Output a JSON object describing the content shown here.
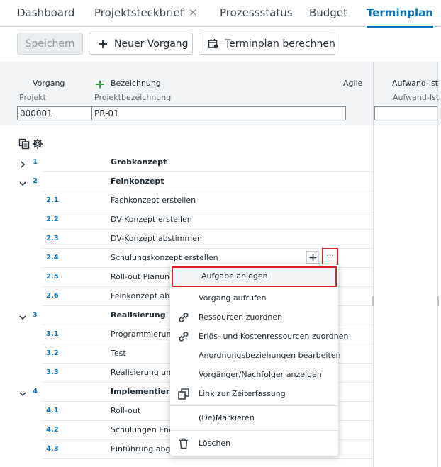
{
  "tabs": [
    {
      "label": "Dashboard"
    },
    {
      "label": "Projektsteckbrief",
      "close": "✕"
    },
    {
      "label": "Prozessstatus"
    },
    {
      "label": "Budget"
    },
    {
      "label": "Terminplan"
    }
  ],
  "toolbar": {
    "save_label": "Speichern",
    "new_task_label": "Neuer Vorgang",
    "calc_label": "Terminplan berechnen"
  },
  "header": {
    "vorgang": "Vorgang",
    "bezeichnung": "Bezeichnung",
    "agile": "Agile",
    "aufwand": "Aufwand-Ist",
    "projekt": "Projekt",
    "projektbezeichnung": "Projektbezeichnung",
    "aufwand_sub": "Aufwand-Ist",
    "projekt_value": "000001",
    "bezeichnung_value": "PR-01",
    "aufwand_value": ""
  },
  "rows": [
    {
      "num": "1",
      "text": "Grobkonzept",
      "level": 1,
      "expanded": false
    },
    {
      "num": "2",
      "text": "Feinkonzept",
      "level": 1,
      "expanded": true
    },
    {
      "num": "2.1",
      "text": "Fachkonzept erstellen",
      "level": 2
    },
    {
      "num": "2.2",
      "text": "DV-Konzept erstellen",
      "level": 2
    },
    {
      "num": "2.3",
      "text": "DV-Konzept abstimmen",
      "level": 2
    },
    {
      "num": "2.4",
      "text": "Schulungskonzept erstellen",
      "level": 2
    },
    {
      "num": "2.5",
      "text": "Roll-out Planung",
      "level": 2
    },
    {
      "num": "2.6",
      "text": "Feinkonzept abge",
      "level": 2
    },
    {
      "num": "3",
      "text": "Realisierung",
      "level": 1,
      "expanded": true
    },
    {
      "num": "3.1",
      "text": "Programmierung",
      "level": 2
    },
    {
      "num": "3.2",
      "text": "Test",
      "level": 2
    },
    {
      "num": "3.3",
      "text": "Realisierung und",
      "level": 2
    },
    {
      "num": "4",
      "text": "Implementierung",
      "level": 1,
      "expanded": true
    },
    {
      "num": "4.1",
      "text": "Roll-out",
      "level": 2
    },
    {
      "num": "4.2",
      "text": "Schulungen Enda",
      "level": 2
    },
    {
      "num": "4.3",
      "text": "Einführung abges",
      "level": 2
    }
  ],
  "row_actions": {
    "more": "···"
  },
  "menu": {
    "items": [
      {
        "label": "Aufgabe anlegen",
        "icon": "",
        "highlighted": true
      },
      {
        "label": "Vorgang aufrufen",
        "icon": ""
      },
      {
        "label": "Ressourcen zuordnen",
        "icon": "link-icon"
      },
      {
        "label": "Erlös- und Kostenressourcen zuordnen",
        "icon": "link-icon"
      },
      {
        "label": "Anordnungsbeziehungen bearbeiten",
        "icon": ""
      },
      {
        "label": "Vorgänger/Nachfolger anzeigen",
        "icon": ""
      },
      {
        "label": "Link zur Zeiterfassung",
        "icon": "copy-icon"
      },
      {
        "label": "(De)Markieren",
        "icon": ""
      },
      {
        "label": "Löschen",
        "icon": "trash-icon"
      }
    ]
  },
  "colors": {
    "accent": "#0a73b5",
    "highlight": "#d81f26",
    "plus": "#2e9b3b"
  }
}
